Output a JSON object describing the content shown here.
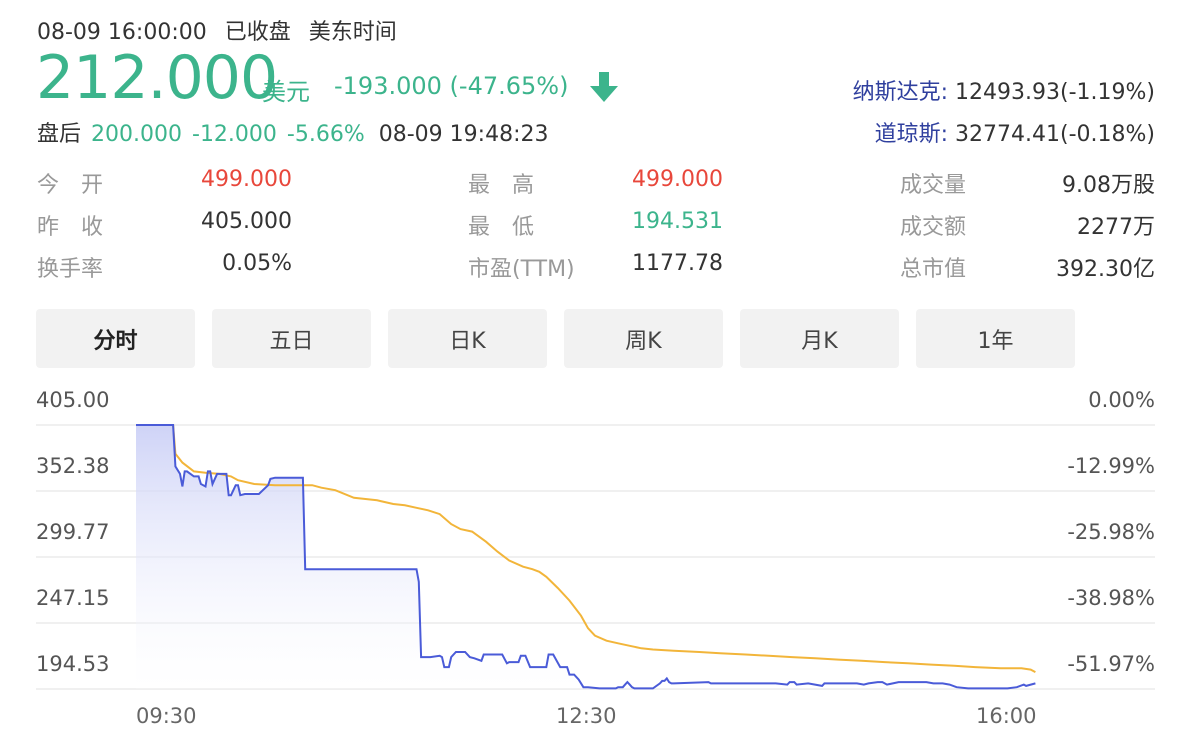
{
  "status": {
    "datetime": "08-09 16:00:00",
    "state": "已收盘",
    "tz": "美东时间"
  },
  "quote": {
    "price": "212.000",
    "currency": "美元",
    "change": "-193.000",
    "change_pct": "(-47.65%)",
    "direction_icon": "down-arrow-icon",
    "color": "#3cb48c"
  },
  "indices": [
    {
      "name": "纳斯达克:",
      "value": "12493.93(-1.19%)"
    },
    {
      "name": "道琼斯:",
      "value": "32774.41(-0.18%)"
    }
  ],
  "after_hours": {
    "label": "盘后",
    "price": "200.000",
    "change": "-12.000",
    "pct": "-5.66%",
    "time": "08-09 19:48:23"
  },
  "stats": [
    {
      "label": "今　开",
      "value": "499.000",
      "tone": "red"
    },
    {
      "label": "最　高",
      "value": "499.000",
      "tone": "red"
    },
    {
      "label": "成交量",
      "value": "9.08万股",
      "tone": ""
    },
    {
      "label": "昨　收",
      "value": "405.000",
      "tone": ""
    },
    {
      "label": "最　低",
      "value": "194.531",
      "tone": "green"
    },
    {
      "label": "成交额",
      "value": "2277万",
      "tone": ""
    },
    {
      "label": "换手率",
      "value": "0.05%",
      "tone": ""
    },
    {
      "label": "市盈(TTM)",
      "value": "1177.78",
      "tone": ""
    },
    {
      "label": "总市值",
      "value": "392.30亿",
      "tone": ""
    }
  ],
  "tabs": [
    {
      "label": "分时",
      "active": true
    },
    {
      "label": "五日",
      "active": false
    },
    {
      "label": "日K",
      "active": false
    },
    {
      "label": "周K",
      "active": false
    },
    {
      "label": "月K",
      "active": false
    },
    {
      "label": "1年",
      "active": false
    }
  ],
  "chart_data": {
    "type": "line",
    "y_left_ticks": [
      "405.00",
      "352.38",
      "299.77",
      "247.15",
      "194.53"
    ],
    "y_right_ticks": [
      "0.00%",
      "-12.99%",
      "-25.98%",
      "-38.98%",
      "-51.97%"
    ],
    "x_ticks": [
      "09:30",
      "12:30",
      "16:00"
    ],
    "ylim": [
      194.53,
      405.0
    ],
    "x_range_minutes": [
      0,
      390
    ],
    "grid": true,
    "colors": {
      "price": "#4a5bd8",
      "avg": "#f2b53a",
      "fill": "#d9ddf8"
    },
    "series": [
      {
        "color": "#4a5bd8",
        "points": [
          [
            0,
            405
          ],
          [
            1,
            405
          ],
          [
            16,
            405
          ],
          [
            17,
            372
          ],
          [
            19,
            366
          ],
          [
            20,
            356
          ],
          [
            21,
            368
          ],
          [
            22,
            368
          ],
          [
            25,
            364
          ],
          [
            27,
            364
          ],
          [
            28,
            358
          ],
          [
            30,
            356
          ],
          [
            31,
            368
          ],
          [
            32,
            368
          ],
          [
            33,
            358
          ],
          [
            35,
            366
          ],
          [
            37,
            366
          ],
          [
            39,
            366
          ],
          [
            40,
            349
          ],
          [
            41,
            349
          ],
          [
            43,
            357
          ],
          [
            44,
            357
          ],
          [
            45,
            349
          ],
          [
            47,
            350
          ],
          [
            49,
            350
          ],
          [
            53,
            350
          ],
          [
            57,
            357
          ],
          [
            58,
            362
          ],
          [
            60,
            363
          ],
          [
            66,
            363
          ],
          [
            68,
            363
          ],
          [
            69,
            363
          ],
          [
            70,
            363
          ],
          [
            71,
            363
          ],
          [
            72,
            363
          ],
          [
            73,
            290
          ],
          [
            77,
            290
          ],
          [
            121,
            290
          ],
          [
            122,
            280
          ],
          [
            123,
            220
          ],
          [
            127,
            220
          ],
          [
            131,
            221
          ],
          [
            132,
            220
          ],
          [
            133,
            212
          ],
          [
            135,
            212
          ],
          [
            136,
            220
          ],
          [
            138,
            224
          ],
          [
            140,
            224
          ],
          [
            142,
            224
          ],
          [
            144,
            220
          ],
          [
            146,
            219
          ],
          [
            149,
            217
          ],
          [
            150,
            222
          ],
          [
            152,
            222
          ],
          [
            153,
            222
          ],
          [
            155,
            222
          ],
          [
            158,
            222
          ],
          [
            160,
            215
          ],
          [
            161,
            216
          ],
          [
            165,
            216
          ],
          [
            166,
            221
          ],
          [
            168,
            221
          ],
          [
            170,
            212
          ],
          [
            173,
            212
          ],
          [
            175,
            212
          ],
          [
            177,
            212
          ],
          [
            178,
            222
          ],
          [
            180,
            222
          ],
          [
            183,
            212
          ],
          [
            186,
            212
          ],
          [
            187,
            206
          ],
          [
            189,
            206
          ],
          [
            191,
            202
          ],
          [
            193,
            196
          ],
          [
            195,
            196
          ],
          [
            200,
            195
          ],
          [
            207,
            195
          ],
          [
            208,
            196
          ],
          [
            209,
            196
          ],
          [
            210,
            196
          ],
          [
            211,
            198
          ],
          [
            212,
            200
          ],
          [
            213,
            198
          ],
          [
            214,
            196
          ],
          [
            215,
            195
          ],
          [
            218,
            195
          ],
          [
            223,
            195
          ],
          [
            226,
            199
          ],
          [
            227,
            201
          ],
          [
            228,
            201
          ],
          [
            229,
            203
          ],
          [
            230,
            200
          ],
          [
            231,
            199
          ],
          [
            232,
            199
          ],
          [
            247,
            200
          ],
          [
            248,
            199
          ],
          [
            250,
            199
          ],
          [
            253,
            199
          ],
          [
            257,
            199
          ],
          [
            261,
            199
          ],
          [
            264,
            199
          ],
          [
            271,
            199
          ],
          [
            276,
            199
          ],
          [
            281,
            198
          ],
          [
            282,
            200
          ],
          [
            284,
            200
          ],
          [
            285,
            198
          ],
          [
            290,
            199
          ],
          [
            296,
            197
          ],
          [
            297,
            199
          ],
          [
            300,
            199
          ],
          [
            303,
            199
          ],
          [
            305,
            199
          ],
          [
            309,
            199
          ],
          [
            311,
            199
          ],
          [
            314,
            198
          ],
          [
            316,
            199
          ],
          [
            320,
            200
          ],
          [
            322,
            200
          ],
          [
            324,
            198
          ],
          [
            329,
            200
          ],
          [
            333,
            200
          ],
          [
            341,
            200
          ],
          [
            344,
            199
          ],
          [
            348,
            199
          ],
          [
            351,
            198
          ],
          [
            354,
            196
          ],
          [
            359,
            195
          ],
          [
            364,
            195
          ],
          [
            371,
            195
          ],
          [
            376,
            195
          ],
          [
            380,
            196
          ],
          [
            383,
            198
          ],
          [
            384,
            197
          ],
          [
            388,
            199
          ]
        ]
      },
      {
        "color": "#f2b53a",
        "points": [
          [
            0,
            405
          ],
          [
            16,
            405
          ],
          [
            17,
            382
          ],
          [
            20,
            375
          ],
          [
            25,
            368
          ],
          [
            30,
            367
          ],
          [
            36,
            366
          ],
          [
            41,
            364
          ],
          [
            44,
            361
          ],
          [
            51,
            358
          ],
          [
            60,
            357
          ],
          [
            70,
            357
          ],
          [
            76,
            357
          ],
          [
            80,
            355
          ],
          [
            86,
            353
          ],
          [
            94,
            347
          ],
          [
            104,
            345
          ],
          [
            111,
            342
          ],
          [
            116,
            341
          ],
          [
            121,
            339
          ],
          [
            126,
            337
          ],
          [
            131,
            334
          ],
          [
            136,
            326
          ],
          [
            140,
            322
          ],
          [
            145,
            320
          ],
          [
            151,
            312
          ],
          [
            156,
            304
          ],
          [
            161,
            297
          ],
          [
            167,
            292
          ],
          [
            171,
            290
          ],
          [
            174,
            288
          ],
          [
            177,
            284
          ],
          [
            182,
            275
          ],
          [
            187,
            265
          ],
          [
            192,
            253
          ],
          [
            195,
            243
          ],
          [
            198,
            237
          ],
          [
            203,
            233
          ],
          [
            208,
            231
          ],
          [
            213,
            229
          ],
          [
            218,
            227
          ],
          [
            223,
            226
          ],
          [
            232,
            225
          ],
          [
            243,
            224
          ],
          [
            252,
            223
          ],
          [
            263,
            222
          ],
          [
            273,
            221
          ],
          [
            283,
            220
          ],
          [
            293,
            219
          ],
          [
            303,
            218
          ],
          [
            313,
            217
          ],
          [
            323,
            216
          ],
          [
            333,
            215
          ],
          [
            343,
            214
          ],
          [
            353,
            213
          ],
          [
            362,
            212
          ],
          [
            373,
            211
          ],
          [
            382,
            211
          ],
          [
            386,
            210
          ],
          [
            388,
            208
          ]
        ]
      }
    ]
  }
}
